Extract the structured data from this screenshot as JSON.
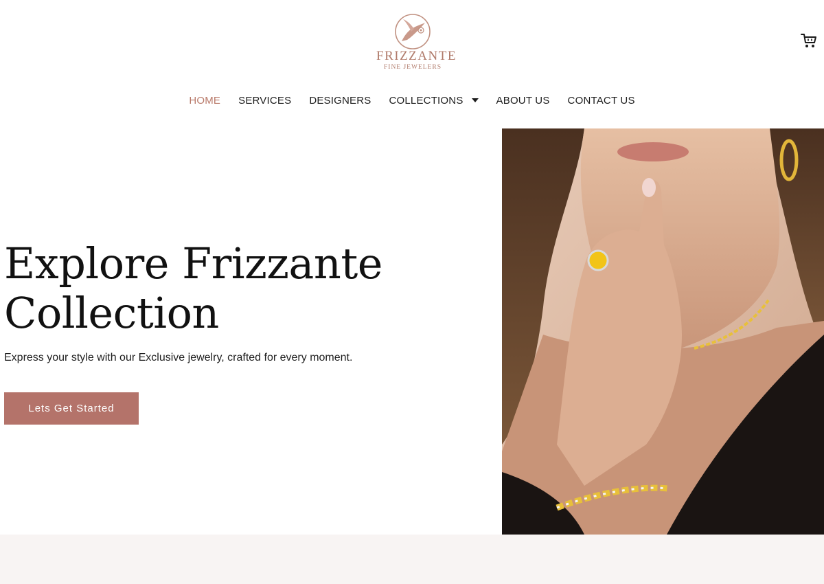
{
  "brand": {
    "name": "FRIZZANTE",
    "tagline": "FINE JEWELERS",
    "logo_icon": "hummingbird-icon",
    "color": "#b07a6a"
  },
  "header": {
    "cart_icon": "shopping-cart-icon"
  },
  "nav": {
    "items": [
      {
        "label": "HOME",
        "active": true
      },
      {
        "label": "SERVICES"
      },
      {
        "label": "DESIGNERS"
      },
      {
        "label": "COLLECTIONS",
        "dropdown": true
      },
      {
        "label": "ABOUT US"
      },
      {
        "label": "CONTACT US"
      }
    ],
    "active_color": "#b97a6a"
  },
  "hero": {
    "title_line1": "Explore Frizzante",
    "title_line2": "Collection",
    "subtitle": "Express your style with our Exclusive jewelry, crafted for every moment.",
    "cta_label": "Lets Get Started",
    "cta_color": "#b4736a"
  },
  "colors": {
    "accent": "#b4736a",
    "bottom_band": "#f8f4f3"
  }
}
